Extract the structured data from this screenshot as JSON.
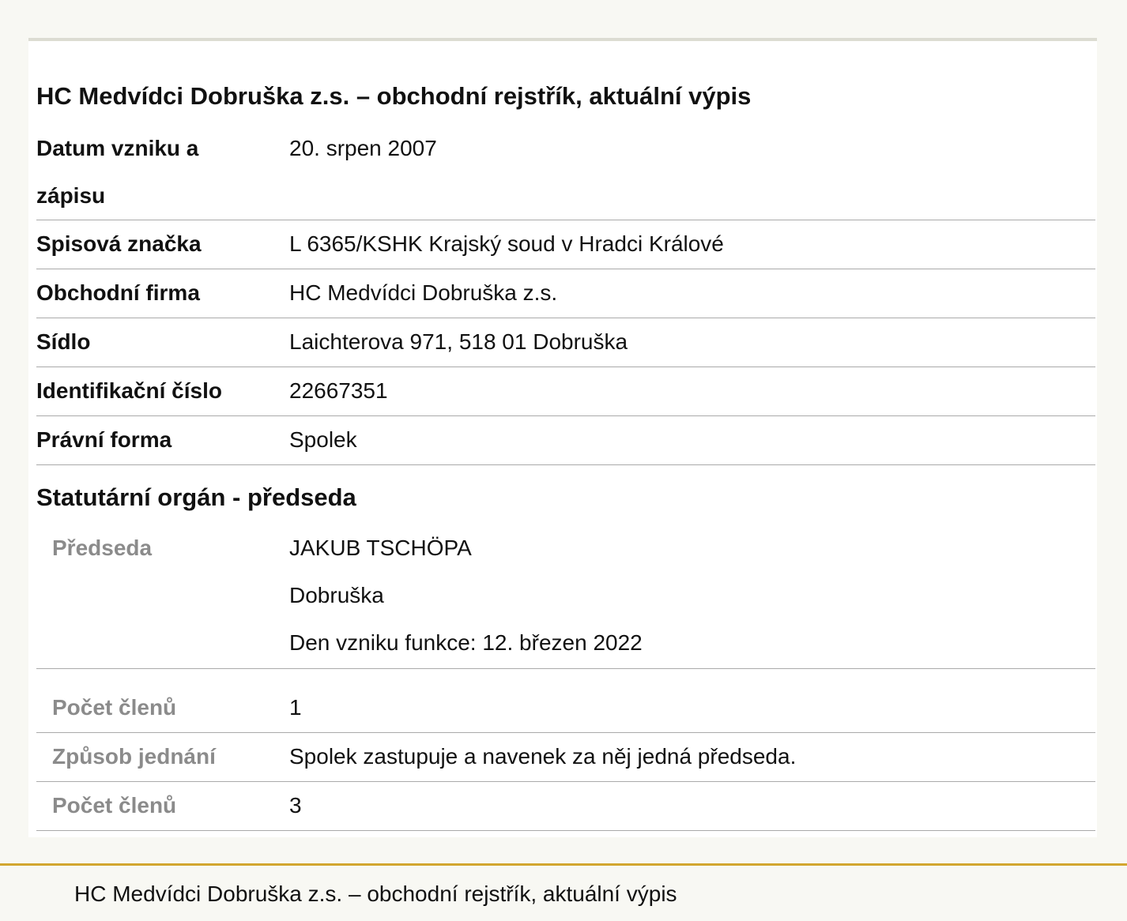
{
  "page": {
    "title": "HC Medvídci Dobruška z.s. – obchodní rejstřík, aktuální výpis"
  },
  "details": [
    {
      "label": "Datum vzniku a zápisu",
      "value": "20. srpen 2007"
    },
    {
      "label": "Spisová značka",
      "value": "L 6365/KSHK Krajský soud v Hradci Králové"
    },
    {
      "label": "Obchodní firma",
      "value": "HC Medvídci Dobruška z.s."
    },
    {
      "label": "Sídlo",
      "value": "Laichterova 971, 518 01 Dobruška"
    },
    {
      "label": "Identifikační číslo",
      "value": "22667351"
    },
    {
      "label": "Právní forma",
      "value": "Spolek"
    }
  ],
  "statutory": {
    "title": "Statutární orgán - předseda",
    "chairman": {
      "label": "Předseda",
      "name": "JAKUB TSCHÖPA",
      "city": "Dobruška",
      "since": "Den vzniku funkce: 12. březen 2022"
    },
    "rows": [
      {
        "label": "Počet členů",
        "value": "1"
      },
      {
        "label": "Způsob jednání",
        "value": "Spolek zastupuje a navenek za něj jedná předseda."
      },
      {
        "label": "Počet členů",
        "value": "3"
      }
    ]
  },
  "footer": {
    "text": "HC Medvídci Dobruška z.s. – obchodní rejstřík, aktuální výpis"
  },
  "colors": {
    "link": "#3a6593",
    "footer_accent": "#d2a62f",
    "muted_label": "#8b8b8b"
  }
}
